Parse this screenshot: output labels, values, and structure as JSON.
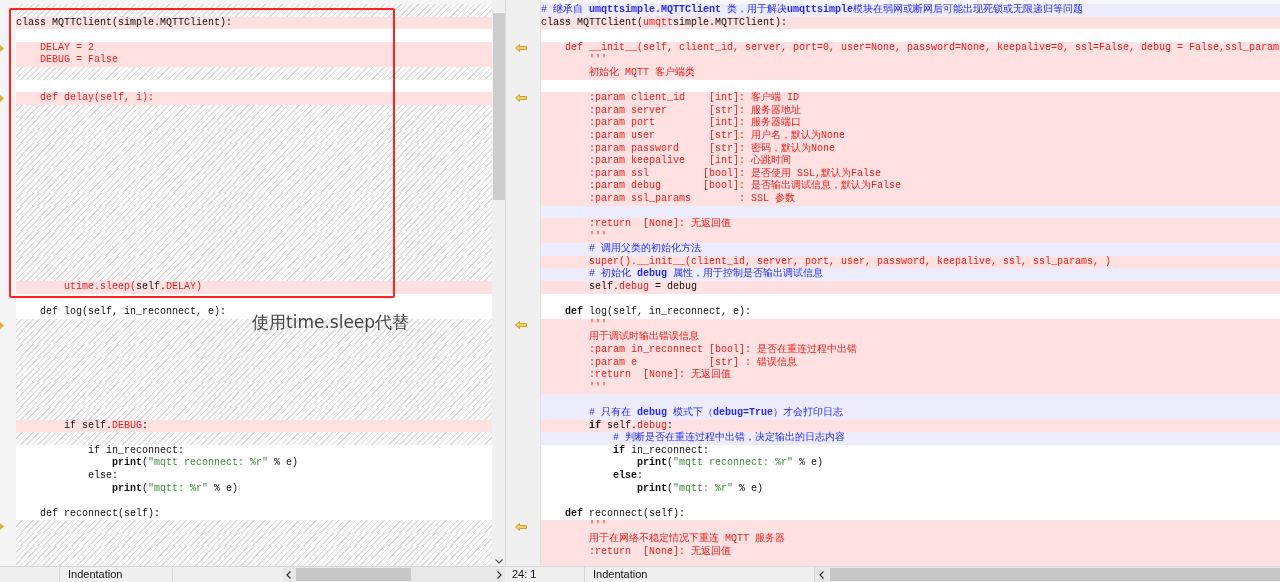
{
  "left_pane": {
    "rows": [
      {
        "kind": "filler",
        "marker": false
      },
      {
        "kind": "changed",
        "marker": false,
        "segments": [
          {
            "text": "class MQTTClient(simple.MQTTClient):",
            "kind": "plain"
          }
        ]
      },
      {
        "kind": "blank",
        "marker": false
      },
      {
        "kind": "changed",
        "marker": true,
        "segments": [
          {
            "text": "    DELAY = 2",
            "kind": "red"
          }
        ]
      },
      {
        "kind": "changed",
        "marker": false,
        "segments": [
          {
            "text": "    DEBUG = False",
            "kind": "red"
          }
        ]
      },
      {
        "kind": "filler",
        "marker": false
      },
      {
        "kind": "blank",
        "marker": false
      },
      {
        "kind": "changed",
        "marker": true,
        "segments": [
          {
            "text": "    def delay(self, i):",
            "kind": "red"
          }
        ]
      },
      {
        "kind": "filler",
        "marker": false
      },
      {
        "kind": "filler",
        "marker": false
      },
      {
        "kind": "filler",
        "marker": false
      },
      {
        "kind": "filler",
        "marker": false
      },
      {
        "kind": "filler",
        "marker": false
      },
      {
        "kind": "filler",
        "marker": false
      },
      {
        "kind": "filler",
        "marker": false
      },
      {
        "kind": "filler",
        "marker": false
      },
      {
        "kind": "filler",
        "marker": false
      },
      {
        "kind": "filler",
        "marker": false
      },
      {
        "kind": "filler",
        "marker": false
      },
      {
        "kind": "filler",
        "marker": false
      },
      {
        "kind": "filler",
        "marker": false
      },
      {
        "kind": "filler",
        "marker": false
      },
      {
        "kind": "changed",
        "marker": false,
        "segments": [
          {
            "text": "        utime.sleep(",
            "kind": "red"
          },
          {
            "text": "self.",
            "kind": "plain"
          },
          {
            "text": "DELAY)",
            "kind": "red"
          }
        ]
      },
      {
        "kind": "blank",
        "marker": false
      },
      {
        "kind": "plain",
        "marker": false,
        "segments": [
          {
            "text": "    def log(self, in_reconnect, e):",
            "kind": "plain"
          }
        ]
      },
      {
        "kind": "filler",
        "marker": true
      },
      {
        "kind": "filler",
        "marker": false
      },
      {
        "kind": "filler",
        "marker": false
      },
      {
        "kind": "filler",
        "marker": false
      },
      {
        "kind": "filler",
        "marker": false
      },
      {
        "kind": "filler",
        "marker": false
      },
      {
        "kind": "filler",
        "marker": false
      },
      {
        "kind": "filler",
        "marker": false
      },
      {
        "kind": "changed",
        "marker": false,
        "segments": [
          {
            "text": "        if self.",
            "kind": "plain"
          },
          {
            "text": "DEBUG",
            "kind": "red"
          },
          {
            "text": ":",
            "kind": "plain"
          }
        ]
      },
      {
        "kind": "filler",
        "marker": false
      },
      {
        "kind": "plain",
        "marker": false,
        "segments": [
          {
            "text": "            if in_reconnect:",
            "kind": "plain"
          }
        ]
      },
      {
        "kind": "plain",
        "marker": false,
        "segments": [
          {
            "text": "                print",
            "kind": "bold"
          },
          {
            "text": "(",
            "kind": "plain"
          },
          {
            "text": "\"mqtt reconnect: %r\"",
            "kind": "string"
          },
          {
            "text": " % e)",
            "kind": "plain"
          }
        ]
      },
      {
        "kind": "plain",
        "marker": false,
        "segments": [
          {
            "text": "            else:",
            "kind": "plain"
          }
        ]
      },
      {
        "kind": "plain",
        "marker": false,
        "segments": [
          {
            "text": "                print",
            "kind": "bold"
          },
          {
            "text": "(",
            "kind": "plain"
          },
          {
            "text": "\"mqtt: %r\"",
            "kind": "string"
          },
          {
            "text": " % e)",
            "kind": "plain"
          }
        ]
      },
      {
        "kind": "blank",
        "marker": false
      },
      {
        "kind": "plain",
        "marker": false,
        "segments": [
          {
            "text": "    def reconnect(self):",
            "kind": "plain"
          }
        ]
      },
      {
        "kind": "filler",
        "marker": true
      },
      {
        "kind": "filler",
        "marker": false
      },
      {
        "kind": "filler",
        "marker": false
      },
      {
        "kind": "filler",
        "marker": false
      }
    ]
  },
  "right_pane": {
    "rows": [
      {
        "kind": "comment",
        "marker": false,
        "segments": [
          {
            "text": "# 继承自 ",
            "kind": "comment"
          },
          {
            "text": "umqttsimple.MQTTClient",
            "kind": "comment-bold"
          },
          {
            "text": " 类，用于解决",
            "kind": "comment"
          },
          {
            "text": "umqttsimple",
            "kind": "comment-bold"
          },
          {
            "text": "模块在弱网或断网后可能出现死锁或无限递归等问题",
            "kind": "comment"
          }
        ]
      },
      {
        "kind": "changed",
        "marker": false,
        "segments": [
          {
            "text": "class MQTTClient(",
            "kind": "plain"
          },
          {
            "text": "umqtt",
            "kind": "red"
          },
          {
            "text": "simple.MQTTClient):",
            "kind": "plain"
          }
        ]
      },
      {
        "kind": "blank",
        "marker": false
      },
      {
        "kind": "changed",
        "marker": true,
        "segments": [
          {
            "text": "    def __init__(self, client_id, server, port=0, user=None, password=None, keepalive=0, ssl=False, debug = False,ssl_param",
            "kind": "red"
          }
        ]
      },
      {
        "kind": "changed",
        "marker": false,
        "segments": [
          {
            "text": "        '''",
            "kind": "red"
          }
        ]
      },
      {
        "kind": "changed",
        "marker": false,
        "segments": [
          {
            "text": "        初始化 MQTT 客户端类",
            "kind": "red"
          }
        ]
      },
      {
        "kind": "blank",
        "marker": false
      },
      {
        "kind": "changed",
        "marker": true,
        "segments": [
          {
            "text": "        :param client_id    [int]: 客户端 ID",
            "kind": "red"
          }
        ]
      },
      {
        "kind": "changed",
        "marker": false,
        "segments": [
          {
            "text": "        :param server       [str]: 服务器地址",
            "kind": "red"
          }
        ]
      },
      {
        "kind": "changed",
        "marker": false,
        "segments": [
          {
            "text": "        :param port         [int]: 服务器端口",
            "kind": "red"
          }
        ]
      },
      {
        "kind": "changed",
        "marker": false,
        "segments": [
          {
            "text": "        :param user         [str]: 用户名，默认为None",
            "kind": "red"
          }
        ]
      },
      {
        "kind": "changed",
        "marker": false,
        "segments": [
          {
            "text": "        :param password     [str]: 密码，默认为None",
            "kind": "red"
          }
        ]
      },
      {
        "kind": "changed",
        "marker": false,
        "segments": [
          {
            "text": "        :param keepalive    [int]: 心跳时间",
            "kind": "red"
          }
        ]
      },
      {
        "kind": "changed",
        "marker": false,
        "segments": [
          {
            "text": "        :param ssl         [bool]: 是否使用 SSL,默认为False",
            "kind": "red"
          }
        ]
      },
      {
        "kind": "changed",
        "marker": false,
        "segments": [
          {
            "text": "        :param debug       [bool]: 是否输出调试信息，默认为False",
            "kind": "red"
          }
        ]
      },
      {
        "kind": "changed",
        "marker": false,
        "segments": [
          {
            "text": "        :param ssl_params        : SSL 参数",
            "kind": "red"
          }
        ]
      },
      {
        "kind": "comment",
        "marker": false
      },
      {
        "kind": "changed",
        "marker": false,
        "segments": [
          {
            "text": "        :return  [None]: 无返回值",
            "kind": "red"
          }
        ]
      },
      {
        "kind": "changed",
        "marker": false,
        "segments": [
          {
            "text": "        '''",
            "kind": "red"
          }
        ]
      },
      {
        "kind": "comment",
        "marker": false,
        "segments": [
          {
            "text": "        # 调用父类的初始化方法",
            "kind": "comment"
          }
        ]
      },
      {
        "kind": "changed",
        "marker": false,
        "segments": [
          {
            "text": "        super().__init__(client_id, server, port, user, password, keepalive, ssl, ssl_params, )",
            "kind": "red"
          }
        ]
      },
      {
        "kind": "comment",
        "marker": false,
        "segments": [
          {
            "text": "        # 初始化 ",
            "kind": "comment"
          },
          {
            "text": "debug",
            "kind": "comment-bold"
          },
          {
            "text": " 属性，用于控制是否输出调试信息",
            "kind": "comment"
          }
        ]
      },
      {
        "kind": "changed",
        "marker": false,
        "segments": [
          {
            "text": "        self.",
            "kind": "plain"
          },
          {
            "text": "debug",
            "kind": "red"
          },
          {
            "text": " = debug",
            "kind": "plain"
          }
        ]
      },
      {
        "kind": "blank",
        "marker": false
      },
      {
        "kind": "plain",
        "marker": false,
        "segments": [
          {
            "text": "    def",
            "kind": "bold"
          },
          {
            "text": " log(self, in_reconnect, e):",
            "kind": "plain"
          }
        ]
      },
      {
        "kind": "changed",
        "marker": true,
        "segments": [
          {
            "text": "        '''",
            "kind": "red"
          }
        ]
      },
      {
        "kind": "changed",
        "marker": false,
        "segments": [
          {
            "text": "        用于调试时输出错误信息",
            "kind": "red"
          }
        ]
      },
      {
        "kind": "changed",
        "marker": false,
        "segments": [
          {
            "text": "        :param in_reconnect [bool]: 是否在重连过程中出错",
            "kind": "red"
          }
        ]
      },
      {
        "kind": "changed",
        "marker": false,
        "segments": [
          {
            "text": "        :param e            [str] : 错误信息",
            "kind": "red"
          }
        ]
      },
      {
        "kind": "changed",
        "marker": false,
        "segments": [
          {
            "text": "        :return  [None]: 无返回值",
            "kind": "red"
          }
        ]
      },
      {
        "kind": "changed",
        "marker": false,
        "segments": [
          {
            "text": "        '''",
            "kind": "red"
          }
        ]
      },
      {
        "kind": "comment",
        "marker": false
      },
      {
        "kind": "comment",
        "marker": false,
        "segments": [
          {
            "text": "        # 只有在 ",
            "kind": "comment"
          },
          {
            "text": "debug",
            "kind": "comment-bold"
          },
          {
            "text": " 模式下（",
            "kind": "comment"
          },
          {
            "text": "debug=True",
            "kind": "comment-bold"
          },
          {
            "text": "）才会打印日志",
            "kind": "comment"
          }
        ]
      },
      {
        "kind": "changed",
        "marker": false,
        "segments": [
          {
            "text": "        if",
            "kind": "bold"
          },
          {
            "text": " self.",
            "kind": "plain"
          },
          {
            "text": "debug",
            "kind": "red"
          },
          {
            "text": ":",
            "kind": "plain"
          }
        ]
      },
      {
        "kind": "comment",
        "marker": false,
        "segments": [
          {
            "text": "            # 判断是否在重连过程中出错，决定输出的日志内容",
            "kind": "comment"
          }
        ]
      },
      {
        "kind": "plain",
        "marker": false,
        "segments": [
          {
            "text": "            if",
            "kind": "bold"
          },
          {
            "text": " in_reconnect:",
            "kind": "plain"
          }
        ]
      },
      {
        "kind": "plain",
        "marker": false,
        "segments": [
          {
            "text": "                print",
            "kind": "bold"
          },
          {
            "text": "(",
            "kind": "plain"
          },
          {
            "text": "\"mqtt reconnect: %r\"",
            "kind": "string"
          },
          {
            "text": " % e)",
            "kind": "plain"
          }
        ]
      },
      {
        "kind": "plain",
        "marker": false,
        "segments": [
          {
            "text": "            else",
            "kind": "bold"
          },
          {
            "text": ":",
            "kind": "plain"
          }
        ]
      },
      {
        "kind": "plain",
        "marker": false,
        "segments": [
          {
            "text": "                print",
            "kind": "bold"
          },
          {
            "text": "(",
            "kind": "plain"
          },
          {
            "text": "\"mqtt: %r\"",
            "kind": "string"
          },
          {
            "text": " % e)",
            "kind": "plain"
          }
        ]
      },
      {
        "kind": "blank",
        "marker": false
      },
      {
        "kind": "plain",
        "marker": false,
        "segments": [
          {
            "text": "    def",
            "kind": "bold"
          },
          {
            "text": " reconnect(self):",
            "kind": "plain"
          }
        ]
      },
      {
        "kind": "changed",
        "marker": true,
        "segments": [
          {
            "text": "        '''",
            "kind": "red"
          }
        ]
      },
      {
        "kind": "changed",
        "marker": false,
        "segments": [
          {
            "text": "        用于在网络不稳定情况下重连 MQTT 服务器",
            "kind": "red"
          }
        ]
      },
      {
        "kind": "changed",
        "marker": false,
        "segments": [
          {
            "text": "        :return  [None]: 无返回值",
            "kind": "red"
          }
        ]
      },
      {
        "kind": "changed",
        "marker": false
      }
    ]
  },
  "annotation": {
    "text": "使用time.sleep代替"
  },
  "left_status": {
    "indentation": "Indentation"
  },
  "right_status": {
    "position": "24: 1",
    "indentation": "Indentation"
  }
}
